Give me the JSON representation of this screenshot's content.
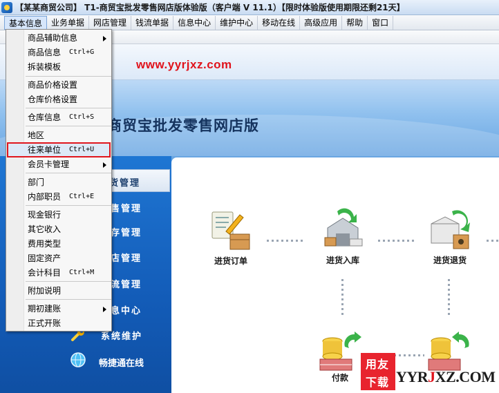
{
  "window": {
    "title": "【某某商贸公司】 T1-商贸宝批发零售网店版体验版（客户端 V 11.1）【限时体验版使用期限还剩21天】"
  },
  "menubar": {
    "items": [
      "基本信息",
      "业务单据",
      "网店管理",
      "钱流单据",
      "信息中心",
      "维护中心",
      "移动在线",
      "高级应用",
      "帮助",
      "窗口"
    ]
  },
  "banner": {
    "url": "www.yyrjxz.com"
  },
  "header": {
    "product_title": "商贸宝批发零售网店版"
  },
  "sidebar": {
    "items": [
      "货管理",
      "售管理",
      "存管理",
      "店管理",
      "流管理",
      "息中心",
      "系统维护",
      "畅捷通在线"
    ]
  },
  "flow": {
    "items": [
      "进货订单",
      "进货入库",
      "进货退货",
      "付款"
    ]
  },
  "dropdown": {
    "items": [
      {
        "label": "商品辅助信息",
        "shortcut": ""
      },
      {
        "label": "商品信息",
        "shortcut": "Ctrl+G"
      },
      {
        "label": "拆装模板",
        "shortcut": ""
      },
      {
        "label": "商品价格设置",
        "shortcut": ""
      },
      {
        "label": "仓库价格设置",
        "shortcut": ""
      },
      {
        "label": "仓库信息",
        "shortcut": "Ctrl+S"
      },
      {
        "label": "地区",
        "shortcut": ""
      },
      {
        "label": "往来单位",
        "shortcut": "Ctrl+U"
      },
      {
        "label": "会员卡管理",
        "shortcut": ""
      },
      {
        "label": "部门",
        "shortcut": ""
      },
      {
        "label": "内部职员",
        "shortcut": "Ctrl+E"
      },
      {
        "label": "现金银行",
        "shortcut": ""
      },
      {
        "label": "其它收入",
        "shortcut": ""
      },
      {
        "label": "费用类型",
        "shortcut": ""
      },
      {
        "label": "固定资产",
        "shortcut": ""
      },
      {
        "label": "会计科目",
        "shortcut": "Ctrl+M"
      },
      {
        "label": "附加说明",
        "shortcut": ""
      },
      {
        "label": "期初建账",
        "shortcut": ""
      },
      {
        "label": "正式开账",
        "shortcut": ""
      }
    ]
  },
  "watermark": {
    "box_line1": "用友",
    "box_line2": "下载",
    "text_a": "YYR",
    "text_b": "J",
    "text_c": "XZ.COM"
  },
  "colors": {
    "sidebar": "#135cb8",
    "highlight_border": "#e0151d",
    "url_red": "#e0121b"
  }
}
